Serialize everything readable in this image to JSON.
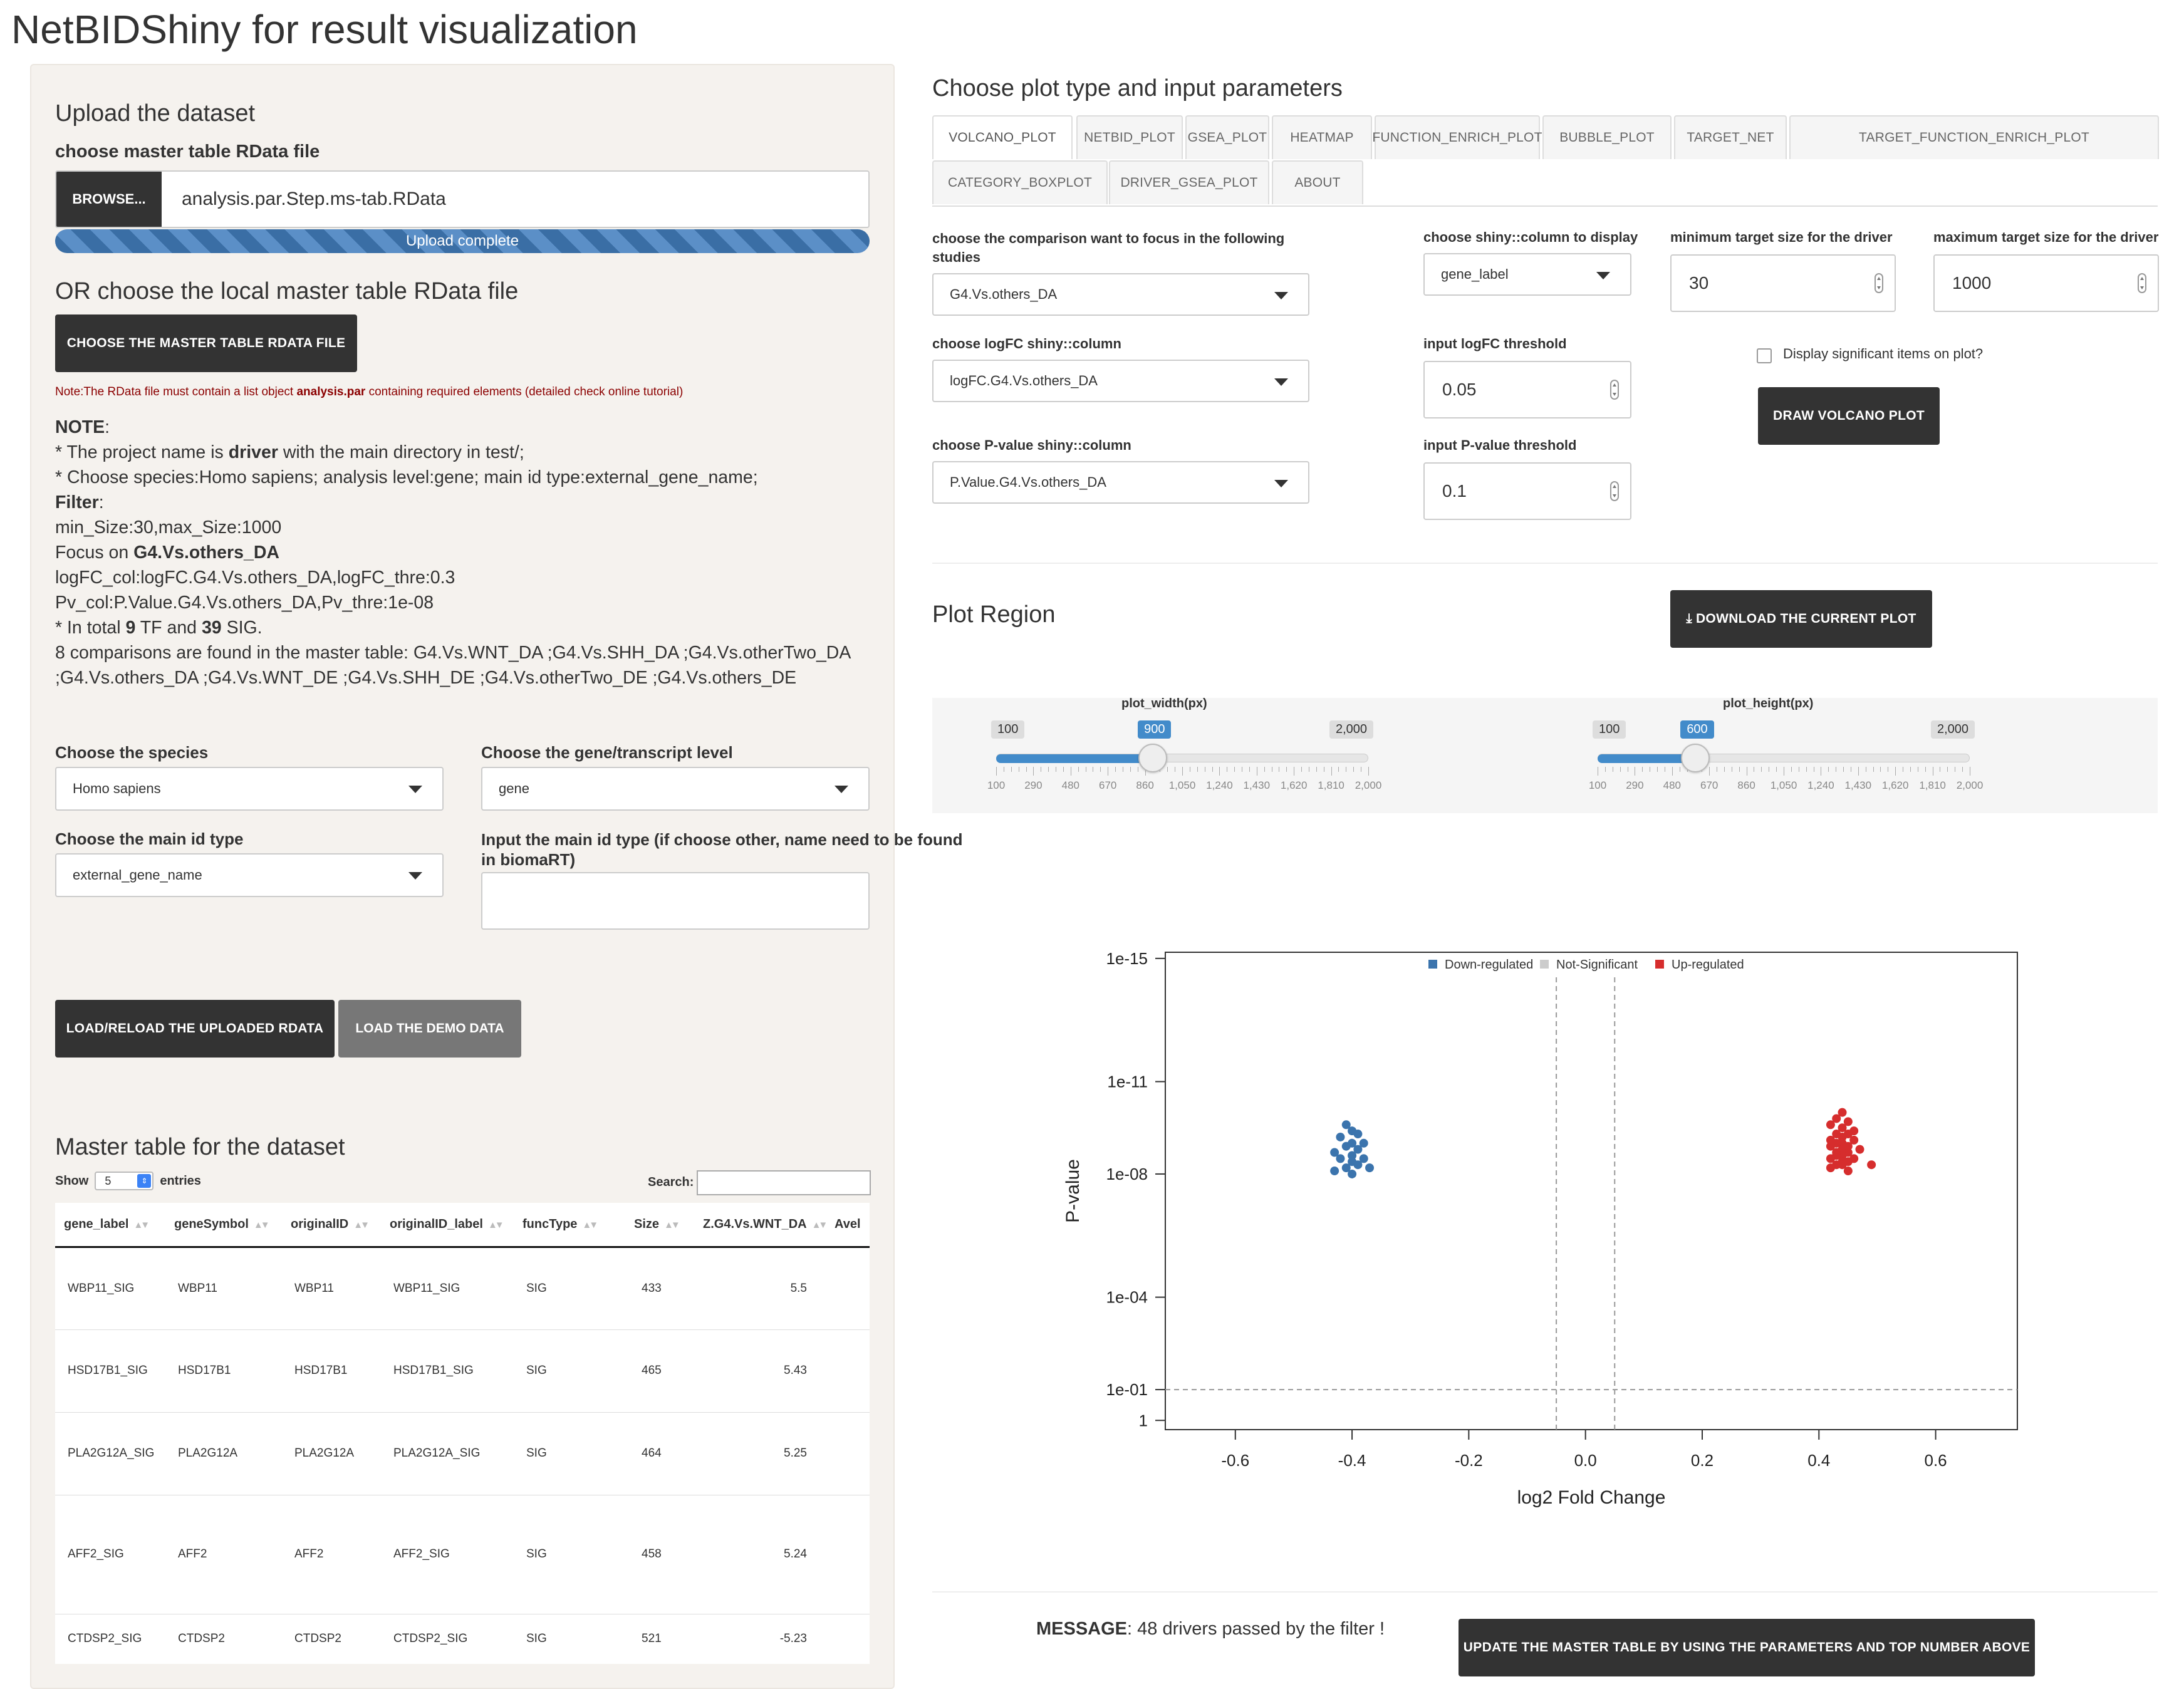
{
  "app_title": "NetBIDShiny for result visualization",
  "upload": {
    "heading": "Upload the dataset",
    "file_label": "choose master table RData file",
    "browse_label": "BROWSE...",
    "file_name": "analysis.par.Step.ms-tab.RData",
    "progress_text": "Upload complete",
    "progress_value": 1.0,
    "local_heading": "OR choose the local master table RData file",
    "choose_button": "CHOOSE THE MASTER TABLE RDATA FILE",
    "note_pre": "Note:The RData file must contain a list object ",
    "note_bold": "analysis.par",
    "note_post": " containing required elements (detailed check online tutorial)"
  },
  "info": {
    "note_label": "NOTE",
    "line1_pre": "* The project name is ",
    "line1_bold": "driver",
    "line1_post": " with the main directory in test/;",
    "line2": "* Choose species:Homo sapiens; analysis level:gene; main id type:external_gene_name;",
    "filter_label": "Filter",
    "line3": "min_Size:30,max_Size:1000",
    "line4_pre": "Focus on ",
    "line4_bold": "G4.Vs.others_DA",
    "line5": "logFC_col:logFC.G4.Vs.others_DA,logFC_thre:0.3",
    "line6": "Pv_col:P.Value.G4.Vs.others_DA,Pv_thre:1e-08",
    "line7_a": "* In total ",
    "line7_b": "9",
    "line7_c": " TF and ",
    "line7_d": "39",
    "line7_e": " SIG.",
    "line8": "8 comparisons are found in the master table: G4.Vs.WNT_DA ;G4.Vs.SHH_DA ;G4.Vs.otherTwo_DA",
    "line9": ";G4.Vs.others_DA ;G4.Vs.WNT_DE ;G4.Vs.SHH_DE ;G4.Vs.otherTwo_DE ;G4.Vs.others_DE"
  },
  "options": {
    "species_label": "Choose the species",
    "species_value": "Homo sapiens",
    "level_label": "Choose the gene/transcript level",
    "level_value": "gene",
    "idtype_label": "Choose the main id type",
    "idtype_value": "external_gene_name",
    "idinput_label_1": "Input the main id type (if choose other, name need to be found",
    "idinput_label_2": "in biomaRT)",
    "idinput_value": "",
    "load_button": "LOAD/RELOAD THE UPLOADED RDATA",
    "demo_button": "LOAD THE DEMO DATA"
  },
  "master_table": {
    "heading": "Master table for the dataset",
    "show_label": "Show",
    "show_value": "5",
    "entries_label": "entries",
    "search_label": "Search:",
    "search_value": "",
    "columns": [
      "gene_label",
      "geneSymbol",
      "originalID",
      "originalID_label",
      "funcType",
      "Size",
      "Z.G4.Vs.WNT_DA",
      "Avel"
    ],
    "rows": [
      [
        "WBP11_SIG",
        "WBP11",
        "WBP11",
        "WBP11_SIG",
        "SIG",
        "433",
        "5.5",
        ""
      ],
      [
        "HSD17B1_SIG",
        "HSD17B1",
        "HSD17B1",
        "HSD17B1_SIG",
        "SIG",
        "465",
        "5.43",
        ""
      ],
      [
        "PLA2G12A_SIG",
        "PLA2G12A",
        "PLA2G12A",
        "PLA2G12A_SIG",
        "SIG",
        "464",
        "5.25",
        ""
      ],
      [
        "AFF2_SIG",
        "AFF2",
        "AFF2",
        "AFF2_SIG",
        "SIG",
        "458",
        "5.24",
        ""
      ],
      [
        "CTDSP2_SIG",
        "CTDSP2",
        "CTDSP2",
        "CTDSP2_SIG",
        "SIG",
        "521",
        "-5.23",
        ""
      ]
    ]
  },
  "plot_params": {
    "heading": "Choose plot type and input parameters",
    "tabs": [
      "VOLCANO_PLOT",
      "NETBID_PLOT",
      "GSEA_PLOT",
      "HEATMAP",
      "FUNCTION_ENRICH_PLOT",
      "BUBBLE_PLOT",
      "TARGET_NET",
      "TARGET_FUNCTION_ENRICH_PLOT",
      "CATEGORY_BOXPLOT",
      "DRIVER_GSEA_PLOT",
      "ABOUT"
    ],
    "active_tab": "VOLCANO_PLOT",
    "comparison_label_1": "choose the comparison want to focus in the following",
    "comparison_label_2": "studies",
    "comparison_value": "G4.Vs.others_DA",
    "display_col_label": "choose shiny::column to display",
    "display_col_value": "gene_label",
    "min_size_label": "minimum target size for the driver",
    "min_size_value": "30",
    "max_size_label": "maximum target size for the driver",
    "max_size_value": "1000",
    "logfc_col_label": "choose logFC shiny::column",
    "logfc_col_value": "logFC.G4.Vs.others_DA",
    "logfc_thre_label": "input logFC threshold",
    "logfc_thre_value": "0.05",
    "sig_checkbox_label": "Display significant items on plot?",
    "draw_button": "DRAW VOLCANO PLOT",
    "pval_col_label": "choose P-value shiny::column",
    "pval_col_value": "P.Value.G4.Vs.others_DA",
    "pval_thre_label": "input P-value threshold",
    "pval_thre_value": "0.1"
  },
  "plot_region": {
    "heading": "Plot Region",
    "download_button": "DOWNLOAD THE CURRENT PLOT",
    "width_slider": {
      "label": "plot_width(px)",
      "min": 100,
      "max": 2000,
      "value": 900,
      "min_label": "100",
      "max_label": "2,000",
      "value_label": "900",
      "ticks": [
        "100",
        "290",
        "480",
        "670",
        "860",
        "1,050",
        "1,240",
        "1,430",
        "1,620",
        "1,810",
        "2,000"
      ]
    },
    "height_slider": {
      "label": "plot_height(px)",
      "min": 100,
      "max": 2000,
      "value": 600,
      "min_label": "100",
      "max_label": "2,000",
      "value_label": "600",
      "ticks": [
        "100",
        "290",
        "480",
        "670",
        "860",
        "1,050",
        "1,240",
        "1,430",
        "1,620",
        "1,810",
        "2,000"
      ]
    }
  },
  "chart_data": {
    "type": "scatter",
    "xlabel": "log2 Fold Change",
    "ylabel": "P-value",
    "xlim": [
      -0.72,
      0.74
    ],
    "x_ticks": [
      -0.6,
      -0.4,
      -0.2,
      0.0,
      0.2,
      0.4,
      0.6
    ],
    "x_tick_labels": [
      "-0.6",
      "-0.4",
      "-0.2",
      "0.0",
      "0.2",
      "0.4",
      "0.6"
    ],
    "y_scale": "log",
    "ylim_neglog10": [
      -0.3,
      15.2
    ],
    "y_ticks": [
      0,
      1,
      4,
      8,
      11,
      15
    ],
    "y_tick_labels": [
      "1",
      "1e-01",
      "1e-04",
      "1e-08",
      "1e-11",
      "1e-15"
    ],
    "vlines": [
      -0.05,
      0.05
    ],
    "hline_p": 0.1,
    "grid": false,
    "legend_position": "top",
    "legend": [
      {
        "name": "Down-regulated",
        "color": "#3b74ad"
      },
      {
        "name": "Not-Significant",
        "color": "#cccccc"
      },
      {
        "name": "Up-regulated",
        "color": "#d62d2d"
      }
    ],
    "series": [
      {
        "name": "Down-regulated",
        "color": "#3b74ad",
        "x": [
          -0.41,
          -0.4,
          -0.39,
          -0.42,
          -0.4,
          -0.38,
          -0.41,
          -0.39,
          -0.43,
          -0.4,
          -0.38,
          -0.42,
          -0.4,
          -0.39,
          -0.41,
          -0.37,
          -0.43,
          -0.4
        ],
        "y_neglog10": [
          9.6,
          9.4,
          9.3,
          9.2,
          9.0,
          9.0,
          8.9,
          8.8,
          8.7,
          8.6,
          8.5,
          8.5,
          8.4,
          8.3,
          8.2,
          8.2,
          8.1,
          8.0
        ]
      },
      {
        "name": "Up-regulated",
        "color": "#d62d2d",
        "x": [
          0.44,
          0.43,
          0.45,
          0.42,
          0.44,
          0.46,
          0.43,
          0.45,
          0.44,
          0.42,
          0.46,
          0.43,
          0.44,
          0.45,
          0.42,
          0.47,
          0.44,
          0.43,
          0.45,
          0.44,
          0.43,
          0.46,
          0.42,
          0.44,
          0.45,
          0.43,
          0.44,
          0.49,
          0.42,
          0.45
        ],
        "y_neglog10": [
          10.0,
          9.8,
          9.7,
          9.6,
          9.5,
          9.4,
          9.3,
          9.3,
          9.2,
          9.1,
          9.1,
          9.0,
          9.0,
          8.9,
          8.9,
          8.8,
          8.8,
          8.7,
          8.7,
          8.6,
          8.6,
          8.5,
          8.5,
          8.4,
          8.4,
          8.3,
          8.3,
          8.3,
          8.2,
          8.1
        ]
      }
    ]
  },
  "message": {
    "label": "MESSAGE",
    "text": ": 48 drivers passed by the filter !",
    "update_button": "UPDATE THE MASTER TABLE BY USING THE PARAMETERS AND TOP NUMBER ABOVE"
  }
}
